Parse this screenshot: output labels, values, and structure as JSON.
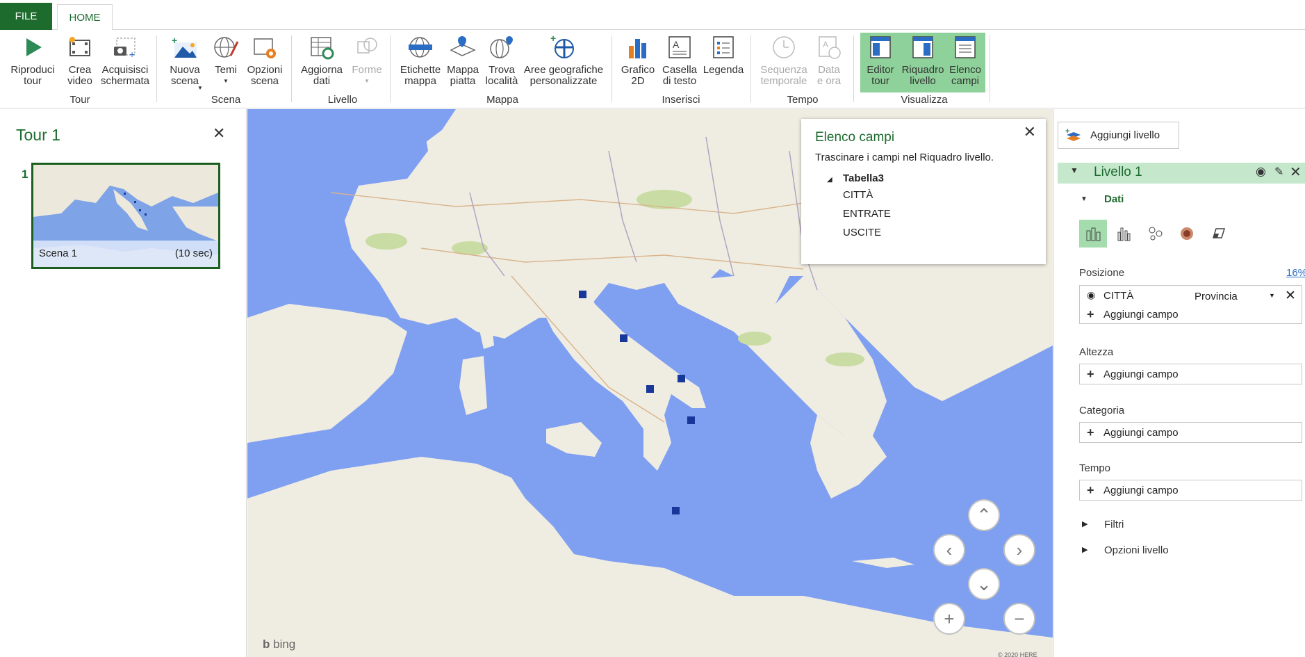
{
  "tabs": {
    "file": "FILE",
    "home": "HOME"
  },
  "ribbon": {
    "buttons": {
      "play_tour": "Riproduci tour",
      "create_video": "Crea video",
      "capture_screen": "Acquisisci schermata",
      "new_scene": "Nuova scena",
      "themes": "Temi",
      "scene_options": "Opzioni scena",
      "refresh_data": "Aggiorna dati",
      "shapes": "Forme",
      "map_labels": "Etichette mappa",
      "flat_map": "Mappa piatta",
      "find_location": "Trova località",
      "custom_regions": "Aree geografiche personalizzate",
      "chart_2d": "Grafico 2D",
      "text_box": "Casella di testo",
      "legend": "Legenda",
      "time_sequence": "Sequenza temporale",
      "date_time": "Data e ora",
      "tour_editor": "Editor tour",
      "layer_pane": "Riquadro livello",
      "field_list": "Elenco campi"
    },
    "groups": {
      "tour": "Tour",
      "scene": "Scena",
      "layer": "Livello",
      "map": "Mappa",
      "insert": "Inserisci",
      "time": "Tempo",
      "view": "Visualizza"
    }
  },
  "tour_panel": {
    "title": "Tour 1",
    "scene_number": "1",
    "scene_name": "Scena 1",
    "scene_duration": "(10 sec)"
  },
  "map": {
    "provider": "bing",
    "copyright": "© 2020 HERE"
  },
  "field_list": {
    "title": "Elenco campi",
    "hint": "Trascinare i campi nel Riquadro livello.",
    "table": "Tabella3",
    "fields": [
      "CITTÀ",
      "ENTRATE",
      "USCITE"
    ]
  },
  "layer_pane": {
    "add_layer": "Aggiungi livello",
    "layer_name": "Livello 1",
    "data_section": "Dati",
    "position_label": "Posizione",
    "position_percent": "16%",
    "position_field": "CITTÀ",
    "position_type": "Provincia",
    "add_field": "Aggiungi campo",
    "height_label": "Altezza",
    "category_label": "Categoria",
    "time_label": "Tempo",
    "filters": "Filtri",
    "layer_options": "Opzioni livello"
  },
  "colors": {
    "accent": "#1e6b2e",
    "selected": "#8fd19a",
    "marker": "#17379a",
    "sea": "#7f9ff0",
    "land": "#efece2"
  }
}
